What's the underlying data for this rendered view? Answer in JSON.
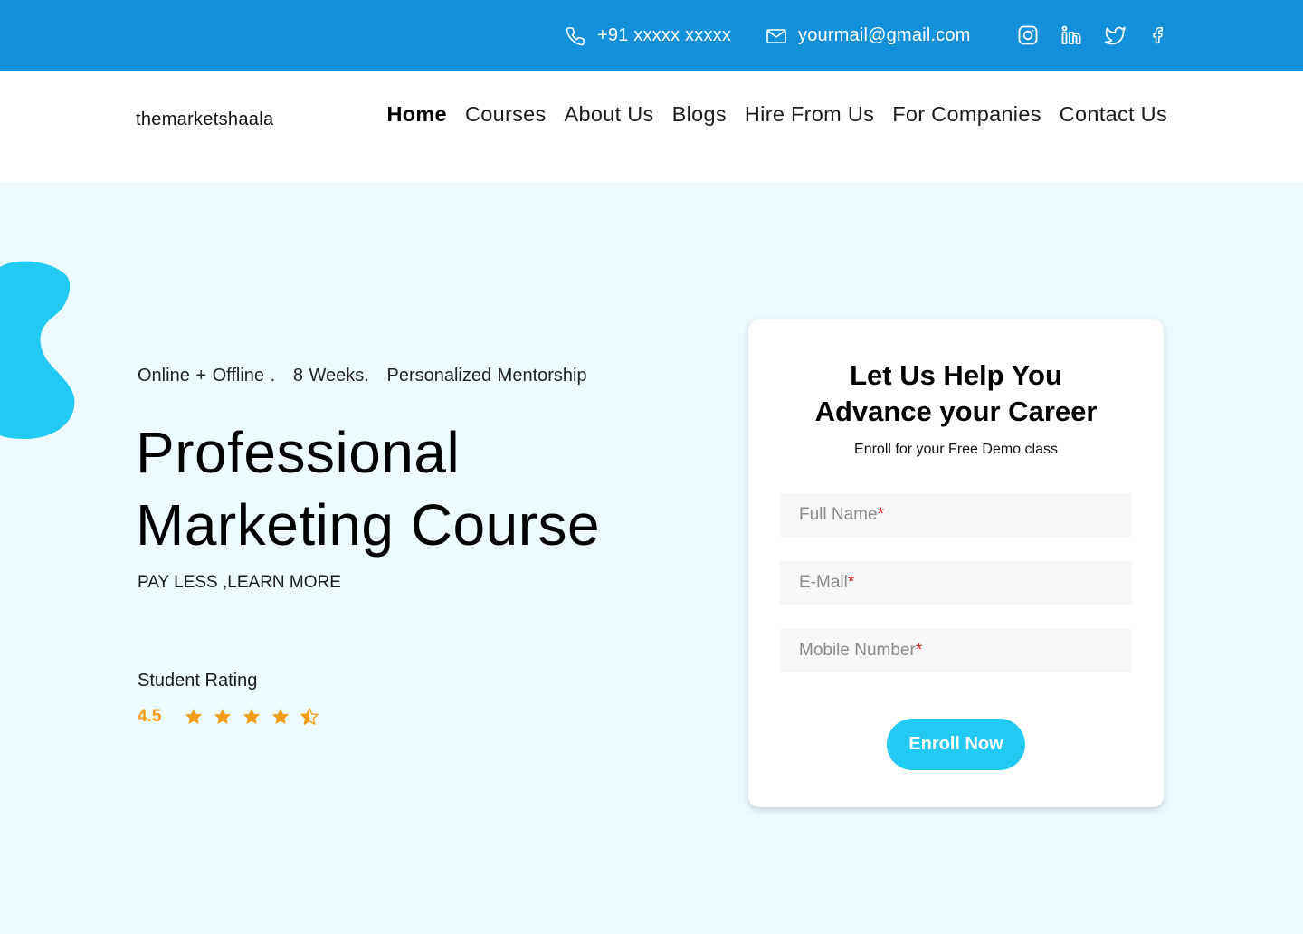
{
  "topbar": {
    "phone": "+91 xxxxx xxxxx",
    "email": "yourmail@gmail.com",
    "social_icons": [
      "instagram-icon",
      "linkedin-icon",
      "twitter-icon",
      "facebook-icon"
    ],
    "background": "#1490da"
  },
  "navbar": {
    "logo": "themarketshaala",
    "items": [
      {
        "label": "Home",
        "active": true
      },
      {
        "label": "Courses"
      },
      {
        "label": "About Us"
      },
      {
        "label": "Blogs"
      },
      {
        "label": "Hire From Us"
      },
      {
        "label": "For Companies"
      },
      {
        "label": "Contact Us"
      }
    ]
  },
  "hero": {
    "tagline": "Online + Offline .   8 Weeks.   Personalized Mentorship",
    "title_line1": "Professional",
    "title_line2": "Marketing Course",
    "subtitle": "PAY LESS ,LEARN MORE",
    "rating_label": "Student Rating",
    "rating_value": "4.5",
    "rating_stars": 4.5,
    "accent_color": "#22c9f2",
    "star_color": "#f39c12"
  },
  "form": {
    "title_line1": "Let Us Help You",
    "title_line2": "Advance your Career",
    "subtitle": "Enroll for your Free Demo class",
    "fields": [
      {
        "placeholder": "Full Name",
        "required_mark": "*"
      },
      {
        "placeholder": "E-Mail",
        "required_mark": "*"
      },
      {
        "placeholder": "Mobile Number",
        "required_mark": "*"
      }
    ],
    "submit_label": "Enroll Now"
  }
}
